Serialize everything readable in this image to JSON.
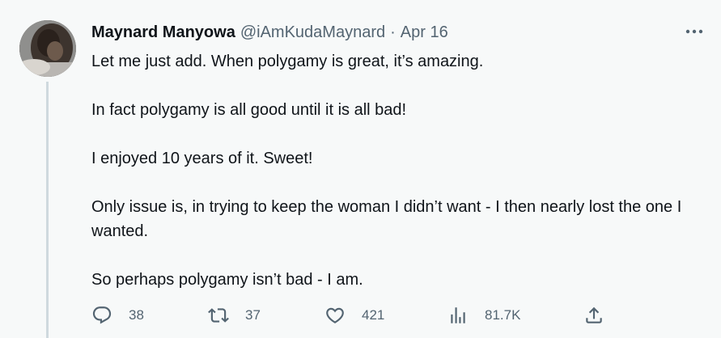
{
  "tweet": {
    "author_name": "Maynard Manyowa",
    "handle": "@iAmKudaMaynard",
    "separator": "·",
    "date": "Apr 16",
    "paragraphs": [
      "Let me just add. When polygamy is great, it’s amazing.",
      "In fact polygamy is all good until it is all bad!",
      "I enjoyed 10 years of it. Sweet!",
      "Only issue is, in trying to keep the woman I didn’t want - I then nearly lost the one I wanted.",
      "So perhaps polygamy isn’t bad - I am."
    ],
    "more_icon": "more-horizontal-icon",
    "actions": {
      "replies": "38",
      "retweets": "37",
      "likes": "421",
      "views": "81.7K"
    }
  },
  "colors": {
    "background": "#f7f9f9",
    "text_primary": "#0f1419",
    "text_secondary": "#536471",
    "thread_line": "#cfd9de"
  }
}
